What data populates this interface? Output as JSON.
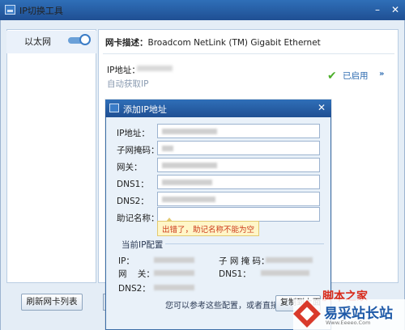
{
  "window": {
    "title": "IP切换工具",
    "minimize_glyph": "–",
    "close_glyph": "✕"
  },
  "sidebar": {
    "items": [
      {
        "label": "以太网"
      }
    ]
  },
  "main": {
    "nic_desc_label": "网卡描述：",
    "nic_desc_value": "Broadcom NetLink (TM) Gigabit Ethernet",
    "ip_label": "IP地址：",
    "auto_ip": "自动获取IP",
    "status": "已启用"
  },
  "footer": {
    "refresh_label": "刷新网卡列表"
  },
  "dialog": {
    "title": "添加IP地址",
    "fields": [
      {
        "label": "IP地址：",
        "value": ""
      },
      {
        "label": "子网掩码：",
        "value": ""
      },
      {
        "label": "网关：",
        "value": ""
      },
      {
        "label": "DNS1：",
        "value": ""
      },
      {
        "label": "DNS2：",
        "value": ""
      },
      {
        "label": "助记名称：",
        "value": ""
      }
    ],
    "error_tip": "出错了，助记名称不能为空",
    "current_config": {
      "title": "当前IP配置",
      "ip_label": "IP：",
      "mask_label": "子 网 掩 码：",
      "gateway_label": "网    关：",
      "dns1_label": "DNS1：",
      "dns2_label": "DNS2："
    },
    "hint": "您可以参考这些配置，或者直接",
    "copy_button": "复制到上面"
  },
  "watermark": {
    "text": "易采站长站",
    "url": "Www.Eeeeo.Com",
    "red_text": "脚本之家"
  },
  "colors": {
    "titlebar": "#2f6fb8",
    "accent": "#2d6bb0",
    "ok": "#4caf2a",
    "error": "#cc3a1b"
  }
}
